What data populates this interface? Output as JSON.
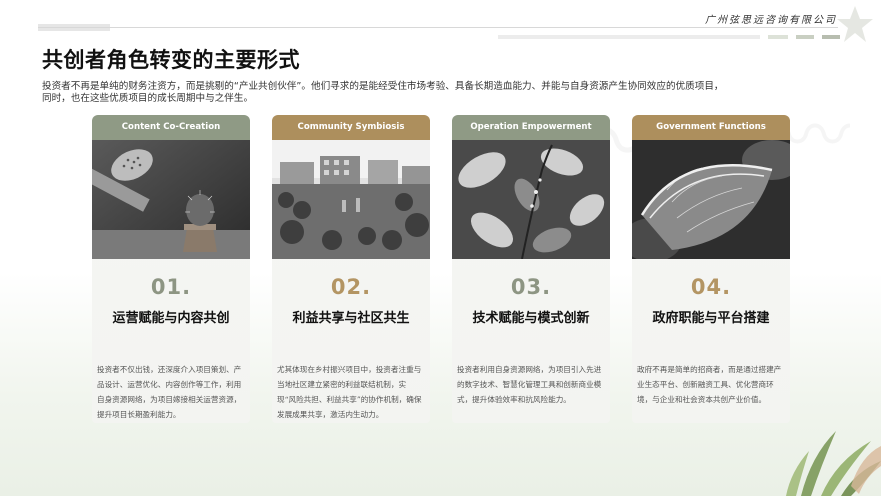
{
  "header": {
    "company": "广州弦思远咨询有限公司"
  },
  "page": {
    "title": "共创者角色转变的主要形式",
    "intro": "投资者不再是单纯的财务注资方，而是挑剔的“产业共创伙伴”。他们寻求的是能经受住市场考验、具备长期造血能力、并能与自身资源产生协同效应的优质项目，同时，也在这些优质项目的成长周期中与之伴生。"
  },
  "colors": {
    "sage": "#8f9a85",
    "gold": "#ad8f5d",
    "sage_num": "#8d9583",
    "gold_num": "#b39563"
  },
  "cards": [
    {
      "tag": "Content Co-Creation",
      "number": "01.",
      "title": "运营赋能与内容共创",
      "desc": "投资者不仅出钱，还深度介入项目策划、产品设计、运营优化、内容创作等工作，利用自身资源网络，为项目嫁接相关运营资源，提升项目长期盈利能力。",
      "image": "cactus-watering-can-photo"
    },
    {
      "tag": "Community Symbiosis",
      "number": "02.",
      "title": "利益共享与社区共生",
      "desc": "尤其体现在乡村振兴项目中，投资者注重与当地社区建立紧密的利益联结机制，实现“风险共担、利益共享”的协作机制，确保发展成果共享，激活内生动力。",
      "image": "community-garden-photo"
    },
    {
      "tag": "Operation Empowerment",
      "number": "03.",
      "title": "技术赋能与模式创新",
      "desc": "投资者利用自身资源网络，为项目引入先进的数字技术、智慧化管理工具和创新商业模式，提升体验效率和抗风险能力。",
      "image": "leaves-branch-photo"
    },
    {
      "tag": "Government Functions",
      "number": "04.",
      "title": "政府职能与平台搭建",
      "desc": "政府不再是简单的招商者，而是通过搭建产业生态平台、创新融资工具、优化营商环境，与企业和社会资本共创产业价值。",
      "image": "hosta-leaf-photo"
    }
  ]
}
